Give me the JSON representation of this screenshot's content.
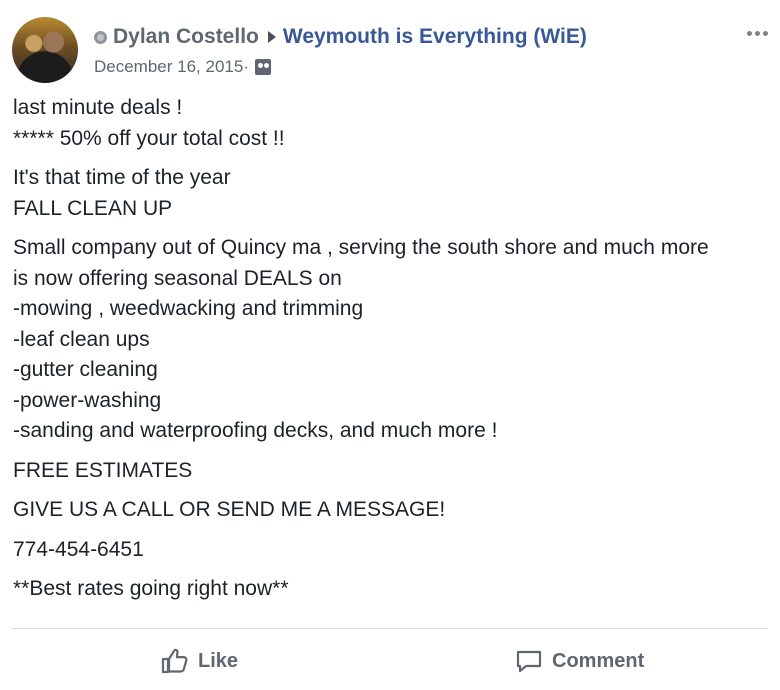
{
  "post": {
    "author": "Dylan Costello",
    "group": "Weymouth is Everything (WiE)",
    "date": "December 16, 2015",
    "date_separator": " · ",
    "icons": {
      "presence": "globe-icon",
      "arrow": "right-arrow-icon",
      "privacy": "group-privacy-icon",
      "more": "more-options-icon",
      "like": "thumbs-up-icon",
      "comment": "comment-bubble-icon"
    },
    "body": {
      "paragraphs": [
        [
          "last minute deals !",
          "***** 50% off your total cost !!"
        ],
        [
          "It's that time of the year",
          "FALL CLEAN UP"
        ],
        [
          "Small company out of Quincy ma , serving the south shore and much more",
          "is now offering seasonal DEALS on",
          "-mowing , weedwacking and trimming",
          "-leaf clean ups",
          "-gutter cleaning",
          "-power-washing",
          "-sanding and waterproofing decks, and much more !"
        ],
        [
          "FREE ESTIMATES"
        ],
        [
          "GIVE US A CALL OR SEND ME A MESSAGE!"
        ],
        [
          "774-454-6451"
        ],
        [
          "**Best rates going right now**"
        ]
      ]
    },
    "actions": {
      "like": "Like",
      "comment": "Comment"
    },
    "colors": {
      "link_blue": "#385898",
      "meta_gray": "#606770",
      "text": "#1d2129",
      "divider": "#dadde1"
    }
  }
}
